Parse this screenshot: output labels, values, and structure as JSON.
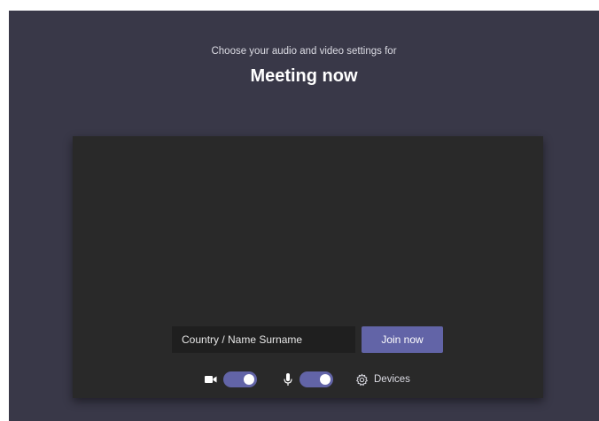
{
  "header": {
    "subtitle": "Choose your audio and video settings for",
    "title": "Meeting now"
  },
  "join_form": {
    "name_value": "Country / Name Surname",
    "join_label": "Join now"
  },
  "controls": {
    "camera_on": true,
    "mic_on": true,
    "devices_label": "Devices"
  },
  "colors": {
    "background": "#393848",
    "preview": "#292929",
    "accent": "#6264a7"
  }
}
